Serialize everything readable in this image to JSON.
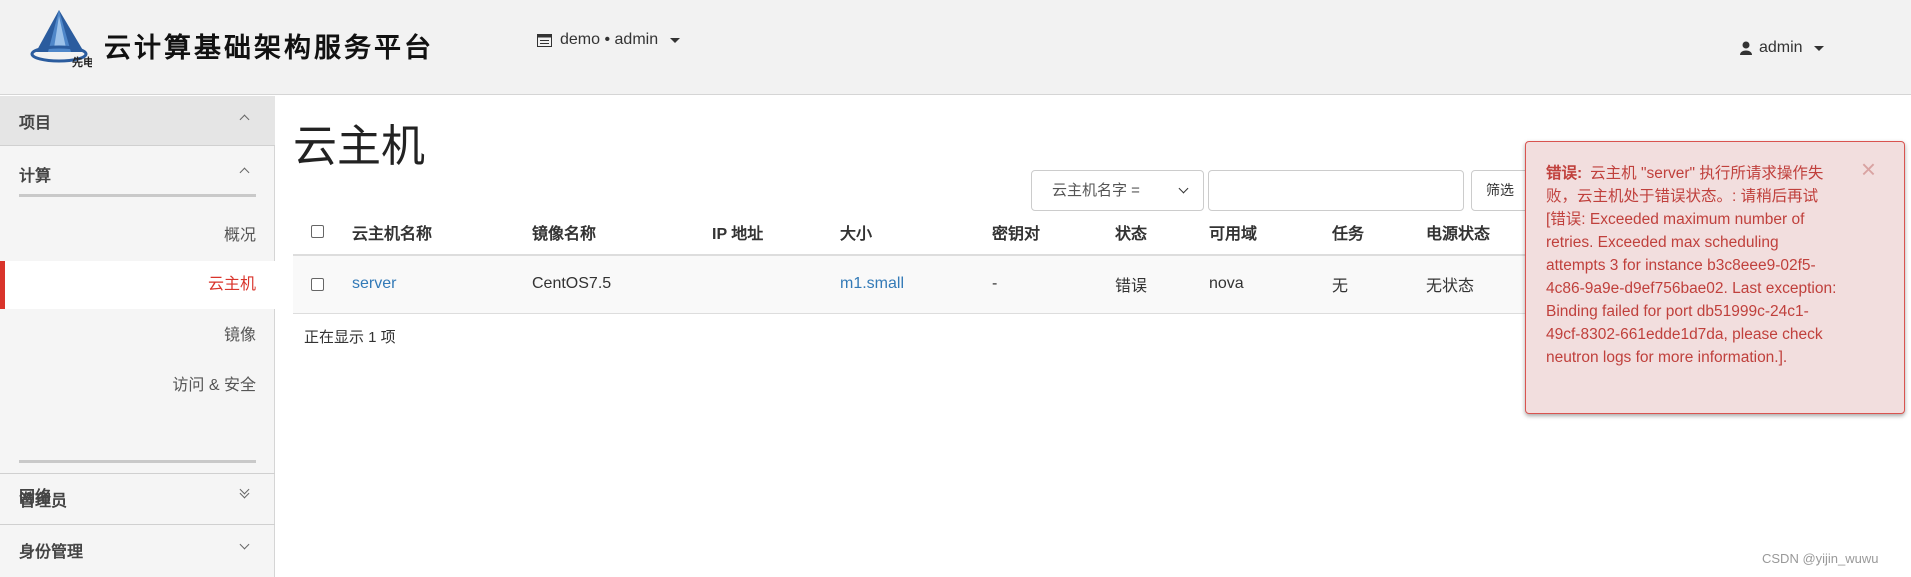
{
  "header": {
    "brand_logo_text": "先电",
    "brand_title": "云计算基础架构服务平台",
    "project_switch": "demo • admin",
    "user_menu": "admin"
  },
  "sidebar": {
    "categories": {
      "project": "项目",
      "compute": "计算",
      "network": "网络",
      "admin": "管理员",
      "identity": "身份管理"
    },
    "compute_items": [
      "概况",
      "云主机",
      "镜像",
      "访问 & 安全"
    ]
  },
  "main": {
    "title": "云主机",
    "filter": {
      "select_value": "云主机名字 =",
      "input_value": "",
      "button_label": "筛选"
    },
    "table": {
      "columns": [
        "云主机名称",
        "镜像名称",
        "IP 地址",
        "大小",
        "密钥对",
        "状态",
        "可用域",
        "任务",
        "电源状态"
      ],
      "rows": [
        [
          "server",
          "CentOS7.5",
          "",
          "m1.small",
          "-",
          "错误",
          "nova",
          "无",
          "无状态"
        ]
      ]
    },
    "row_count": "正在显示 1 项"
  },
  "alert": {
    "label": "错误:",
    "message": "云主机 \"server\" 执行所请求操作失败，云主机处于错误状态。: 请稍后再试 [错误: Exceeded maximum number of retries. Exceeded max scheduling attempts 3 for instance b3c8eee9-02f5-4c86-9a9e-d9ef756bae02. Last exception: Binding failed for port db51999c-24c1-49cf-8302-661edde1d7da, please check neutron logs for more information.].",
    "close": "×"
  },
  "watermark": "CSDN @yijin_wuwu",
  "colors": {
    "accent_red": "#d9342b",
    "link_blue": "#337ab7",
    "alert_bg": "#f2dede",
    "alert_text": "#c0403c"
  }
}
